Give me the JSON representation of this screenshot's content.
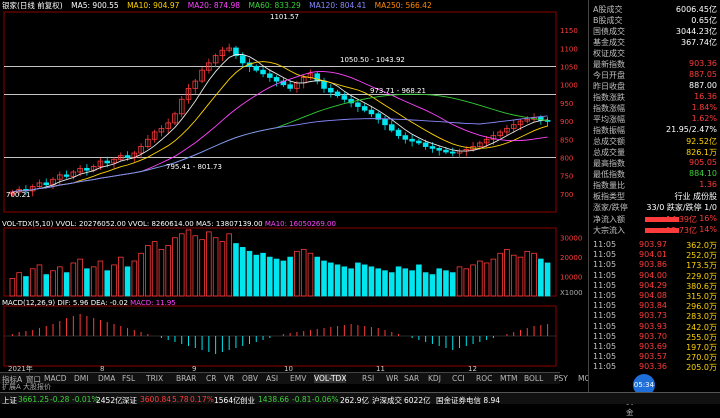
{
  "title": "银家(日线 前复权)",
  "ma_bar": {
    "ma5": "MA5: 900.55",
    "ma10": "MA10: 904.97",
    "ma20": "MA20: 874.98",
    "ma60": "MA60: 833.29",
    "ma120": "MA120: 804.41",
    "ma250": "MA250: 566.42"
  },
  "ma_colors": {
    "ma5": "#e8e8e8",
    "ma10": "#ffd400",
    "ma20": "#ff44ff",
    "ma60": "#33cc33",
    "ma120": "#8888ff",
    "ma250": "#ff8800"
  },
  "annotations": {
    "peak": "1101.57",
    "range1": "1050.50 - 1043.92",
    "range2": "973.71 - 968.21",
    "low1": "795.41 - 801.73",
    "low2": "700.21"
  },
  "vol_bar": {
    "vol": "VOL-TDX(5,10) VVOL: 20276052.00 VVOL: 8260614.00 MA5: 13807139.00",
    "ma10": "MA10: 16050269.00"
  },
  "macd_bar": {
    "label": "MACD(12,26,9) DIF: 5.96 DEA: -0.02",
    "macd": "MACD: 11.95"
  },
  "x_labels": [
    "2021年",
    "8",
    "9",
    "10",
    "11",
    "12"
  ],
  "units": {
    "price": "",
    "vol": "X1000"
  },
  "chart_data": [
    {
      "type": "candlestick",
      "title": "",
      "ylabel": "",
      "ylim": [
        650,
        1200
      ],
      "y_ticks": [
        700,
        750,
        800,
        850,
        900,
        950,
        1000,
        1050,
        1100,
        1150
      ],
      "ref_lines": [
        1050,
        973,
        800
      ],
      "series_summary": "Price rises from ~700 to peak 1101.57 then declines to ~800 and recovers near 900",
      "close": [
        705,
        712,
        708,
        720,
        730,
        725,
        740,
        752,
        748,
        760,
        770,
        765,
        775,
        790,
        785,
        795,
        805,
        800,
        812,
        830,
        850,
        870,
        880,
        895,
        920,
        960,
        990,
        1010,
        1040,
        1060,
        1080,
        1095,
        1101,
        1080,
        1060,
        1050,
        1040,
        1030,
        1020,
        1010,
        1000,
        990,
        1005,
        1020,
        1030,
        1010,
        990,
        980,
        970,
        960,
        950,
        940,
        930,
        920,
        905,
        890,
        875,
        860,
        850,
        845,
        840,
        830,
        825,
        820,
        815,
        812,
        818,
        822,
        830,
        840,
        850,
        860,
        870,
        880,
        890,
        900,
        905,
        910,
        902,
        900
      ],
      "open": [
        700,
        705,
        712,
        708,
        720,
        730,
        725,
        740,
        752,
        748,
        760,
        770,
        765,
        775,
        790,
        785,
        795,
        805,
        800,
        812,
        830,
        850,
        870,
        880,
        895,
        920,
        960,
        990,
        1010,
        1040,
        1060,
        1080,
        1095,
        1101,
        1080,
        1060,
        1050,
        1040,
        1030,
        1020,
        1010,
        1000,
        990,
        1005,
        1020,
        1030,
        1010,
        990,
        980,
        970,
        960,
        950,
        940,
        930,
        920,
        905,
        890,
        875,
        860,
        850,
        845,
        840,
        830,
        825,
        820,
        815,
        812,
        818,
        822,
        830,
        840,
        850,
        860,
        870,
        880,
        890,
        900,
        905,
        910,
        902
      ]
    },
    {
      "type": "bar",
      "title": "",
      "ylabel": "",
      "ylim": [
        0,
        35000
      ],
      "y_ticks": [
        10000,
        20000,
        30000
      ],
      "values": [
        9000,
        12000,
        10000,
        14000,
        16000,
        11000,
        13000,
        15000,
        12000,
        17000,
        19000,
        14000,
        15000,
        18000,
        13000,
        16000,
        20000,
        15000,
        18000,
        22000,
        26000,
        28000,
        24000,
        26000,
        30000,
        32000,
        34000,
        31000,
        29000,
        33000,
        30000,
        28000,
        32000,
        27000,
        25000,
        23000,
        21000,
        22000,
        20000,
        19000,
        18000,
        20000,
        23000,
        24000,
        22000,
        20000,
        18000,
        17000,
        16000,
        15000,
        14000,
        17000,
        16000,
        15000,
        14000,
        13000,
        12000,
        15000,
        14000,
        13000,
        16000,
        12000,
        11000,
        14000,
        13000,
        12000,
        15000,
        14000,
        16000,
        18000,
        17000,
        19000,
        22000,
        24000,
        21000,
        20000,
        23000,
        22000,
        19000,
        17000
      ]
    },
    {
      "type": "bar",
      "title": "",
      "ylabel": "",
      "ylim": [
        -30,
        30
      ],
      "series": [
        {
          "name": "MACD",
          "values": [
            2,
            4,
            5,
            6,
            8,
            10,
            12,
            15,
            18,
            20,
            22,
            20,
            18,
            16,
            14,
            12,
            10,
            8,
            6,
            4,
            2,
            0,
            -2,
            -4,
            -6,
            -8,
            -10,
            -12,
            -14,
            -16,
            -18,
            -16,
            -14,
            -12,
            -10,
            -8,
            -6,
            -4,
            -2,
            0,
            2,
            3,
            4,
            5,
            6,
            7,
            8,
            9,
            10,
            11,
            12,
            11,
            10,
            9,
            8,
            6,
            4,
            2,
            0,
            -2,
            -4,
            -6,
            -8,
            -10,
            -12,
            -14,
            -12,
            -10,
            -8,
            -6,
            -4,
            -2,
            0,
            2,
            4,
            6,
            8,
            10,
            11,
            12
          ]
        },
        {
          "name": "DIF",
          "values": []
        },
        {
          "name": "DEA",
          "values": []
        }
      ]
    }
  ],
  "right_panel": {
    "rows": [
      {
        "k": "A股成交",
        "v": "6006.45亿",
        "c": "wht"
      },
      {
        "k": "B股成交",
        "v": "0.65亿",
        "c": "wht"
      },
      {
        "k": "国债成交",
        "v": "3044.23亿",
        "c": "wht"
      },
      {
        "k": "基金成交",
        "v": "367.74亿",
        "c": "wht"
      },
      {
        "k": "权证成交",
        "v": "",
        "c": "wht"
      },
      {
        "k": "最新指数",
        "v": "903.36",
        "c": "red"
      },
      {
        "k": "今日开盘",
        "v": "887.05",
        "c": "red"
      },
      {
        "k": "昨日收盘",
        "v": "887.00",
        "c": "wht"
      },
      {
        "k": "指数涨跌",
        "v": "16.36",
        "c": "red"
      },
      {
        "k": "指数涨幅",
        "v": "1.84%",
        "c": "red"
      },
      {
        "k": "平均涨幅",
        "v": "1.62%",
        "c": "red"
      },
      {
        "k": "指数振幅",
        "v": "21.95/2.47%",
        "c": "wht"
      },
      {
        "k": "总成交额",
        "v": "92.52亿",
        "c": "yel"
      },
      {
        "k": "总成交量",
        "v": "826.1万",
        "c": "yel"
      },
      {
        "k": "最高指数",
        "v": "905.05",
        "c": "red"
      },
      {
        "k": "最低指数",
        "v": "884.10",
        "c": "grn"
      },
      {
        "k": "指数量比",
        "v": "1.36",
        "c": "red"
      },
      {
        "k": "板指类型",
        "v": "行业 成份股",
        "c": "wht"
      },
      {
        "k": "涨家/跌停",
        "v": "33/0 跌家/跌停 1/0",
        "c": "wht"
      }
    ],
    "flows": [
      {
        "k": "净流入额",
        "v": "14.39亿",
        "p": "16%"
      },
      {
        "k": "大宗流入",
        "v": "12.73亿",
        "p": "14%"
      }
    ],
    "ticks": [
      {
        "t": "11:05",
        "p": "903.97",
        "v": "362.0万"
      },
      {
        "t": "11:05",
        "p": "904.01",
        "v": "252.0万"
      },
      {
        "t": "11:05",
        "p": "903.86",
        "v": "173.5万"
      },
      {
        "t": "11:05",
        "p": "904.00",
        "v": "229.0万"
      },
      {
        "t": "11:05",
        "p": "904.29",
        "v": "380.6万"
      },
      {
        "t": "11:05",
        "p": "904.08",
        "v": "315.0万"
      },
      {
        "t": "11:05",
        "p": "903.84",
        "v": "296.0万"
      },
      {
        "t": "11:05",
        "p": "903.73",
        "v": "283.0万"
      },
      {
        "t": "11:05",
        "p": "903.93",
        "v": "242.0万"
      },
      {
        "t": "11:05",
        "p": "903.70",
        "v": "255.0万"
      },
      {
        "t": "11:05",
        "p": "903.69",
        "v": "197.0万"
      },
      {
        "t": "11:05",
        "p": "903.57",
        "v": "270.0万"
      },
      {
        "t": "11:05",
        "p": "903.36",
        "v": "205.0万"
      }
    ]
  },
  "tabs": [
    "指标A",
    "窗口",
    "MACD",
    "DMI",
    "DMA",
    "FSL",
    "TRIX",
    "BRAR",
    "CR",
    "VR",
    "OBV",
    "ASI",
    "EMV",
    "VOL-TDX",
    "RSI",
    "WR",
    "SAR",
    "KDJ",
    "CCI",
    "ROC",
    "MTM",
    "BOLL",
    "PSY",
    "MCST",
    "筹码",
    "北上资金",
    "指标B",
    "模板"
  ],
  "active_tab": "VOL-TDX",
  "status": {
    "sh_name": "上证",
    "sh_val": "3661.25",
    "sh_chg": "-0.28",
    "sh_pct": "-0.01%",
    "sh_amt": "2452亿",
    "sz_name": "深证",
    "sz_val": "3600.84",
    "sz_chg": "5.78",
    "sz_pct": "0.17%",
    "sz_amt": "1564亿",
    "cy_name": "创业",
    "cy_val": "1438.66",
    "cy_chg": "-0.81",
    "cy_pct": "-0.06%",
    "cy_amt": "262.9亿",
    "mid": "沪深成交",
    "mid2": "6022亿",
    "news": "国金证券电信 8.94",
    "extra": "扩展A  大股报价",
    "clock": "05:34"
  }
}
